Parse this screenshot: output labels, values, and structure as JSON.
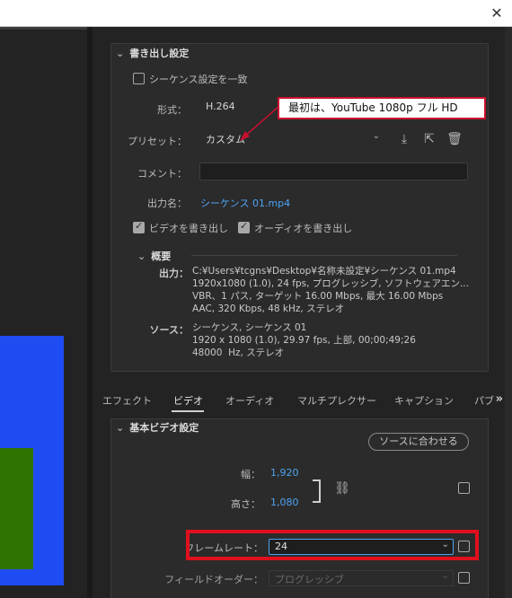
{
  "window": {
    "close_glyph": "✕"
  },
  "export_settings": {
    "title": "書き出し設定",
    "match_sequence_label": "シーケンス設定を一致",
    "format_label": "形式：",
    "format_value": "H.264",
    "preset_label": "プリセット：",
    "preset_value": "カスタム",
    "comment_label": "コメント：",
    "comment_value": "",
    "output_name_label": "出力名：",
    "output_name_value": "シーケンス 01.mp4",
    "export_video_label": "ビデオを書き出し",
    "export_audio_label": "オーディオを書き出し",
    "export_video_checked": true,
    "export_audio_checked": true,
    "match_sequence_checked": false
  },
  "summary": {
    "title": "概要",
    "output_label": "出力：",
    "output_lines": "C:¥Users¥tcgns¥Desktop¥名称未設定¥シーケンス 01.mp4\n1920x1080 (1.0), 24 fps, プログレッシブ, ソフトウェアエン...\nVBR、1 パス, ターゲット 16.00 Mbps, 最大 16.00 Mbps\nAAC, 320 Kbps, 48 kHz, ステレオ",
    "source_label": "ソース：",
    "source_lines": "シーケンス, シーケンス 01\n1920 x 1080 (1.0), 29.97 fps, 上部, 00;00;49;26\n48000  Hz, ステレオ"
  },
  "callout": {
    "text": "最初は、YouTube 1080p フル HD"
  },
  "tabs": {
    "items": [
      "エフェクト",
      "ビデオ",
      "オーディオ",
      "マルチプレクサー",
      "キャプション",
      "パブ"
    ],
    "active": "ビデオ",
    "more_glyph": "»"
  },
  "basic_video": {
    "title": "基本ビデオ設定",
    "match_source_button": "ソースに合わせる",
    "width_label": "幅：",
    "width_value": "1,920",
    "height_label": "高さ：",
    "height_value": "1,080",
    "frame_rate_label": "フレームレート：",
    "frame_rate_value": "24",
    "field_order_label": "フィールドオーダー：",
    "field_order_value": "プログレッシブ"
  },
  "colors": {
    "accent_blue": "#4ea3f2",
    "highlight_red": "#e0101e",
    "preview_blue": "#1e4cf2",
    "preview_green": "#2f7400"
  }
}
